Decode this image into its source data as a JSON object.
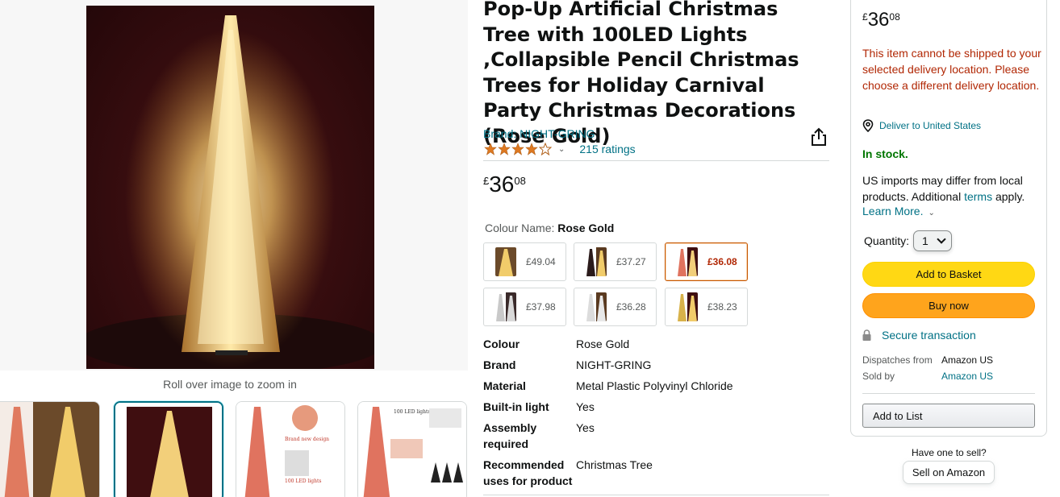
{
  "gallery": {
    "zoom_hint": "Roll over image to zoom in"
  },
  "product": {
    "title": "Pop-Up Artificial Christmas Tree with 100LED Lights ,Collapsible Pencil Christmas Trees for Holiday Carnival Party Christmas Decorations (Rose Gold)",
    "brand_link": "Brand: NIGHT-GRING",
    "rating_stars": 4,
    "ratings_count": "215 ratings",
    "price": {
      "symbol": "£",
      "whole": "36",
      "fraction": "08"
    },
    "colour_label": "Colour Name:",
    "colour_value": "Rose Gold",
    "swatches": [
      {
        "price": "£49.04",
        "selected": false
      },
      {
        "price": "£37.27",
        "selected": false
      },
      {
        "price": "£36.08",
        "selected": true
      },
      {
        "price": "£37.98",
        "selected": false
      },
      {
        "price": "£36.28",
        "selected": false
      },
      {
        "price": "£38.23",
        "selected": false
      }
    ],
    "specs": [
      {
        "key": "Colour",
        "value": "Rose Gold"
      },
      {
        "key": "Brand",
        "value": "NIGHT-GRING"
      },
      {
        "key": "Material",
        "value": "Metal Plastic Polyvinyl Chloride"
      },
      {
        "key": "Built-in light",
        "value": "Yes"
      },
      {
        "key": "Assembly required",
        "value": "Yes"
      },
      {
        "key": "Recommended uses for product",
        "value": "Christmas Tree"
      }
    ]
  },
  "buybox": {
    "price": {
      "symbol": "£",
      "whole": "36",
      "fraction": "08"
    },
    "ship_warning": "This item cannot be shipped to your selected delivery location. Please choose a different delivery location.",
    "deliver_to": "Deliver to United States",
    "stock": "In stock.",
    "import_note_pre": "US imports may differ from local products. Additional ",
    "import_note_link": "terms",
    "import_note_post": " apply.",
    "learn_more": "Learn More.",
    "quantity_label": "Quantity:",
    "quantity_value": "1",
    "add_to_basket": "Add to Basket",
    "buy_now": "Buy now",
    "secure": "Secure transaction",
    "dispatches_from_label": "Dispatches from",
    "dispatches_from_value": "Amazon US",
    "sold_by_label": "Sold by",
    "sold_by_value": "Amazon US",
    "add_to_list": "Add to List"
  },
  "sell": {
    "label": "Have one to sell?",
    "button": "Sell on Amazon"
  },
  "colors": {
    "link": "#007185",
    "warning": "#b12704",
    "in_stock": "#007600",
    "basket_button": "#ffd814",
    "buy_button": "#ffa41c",
    "star": "#de7921"
  }
}
